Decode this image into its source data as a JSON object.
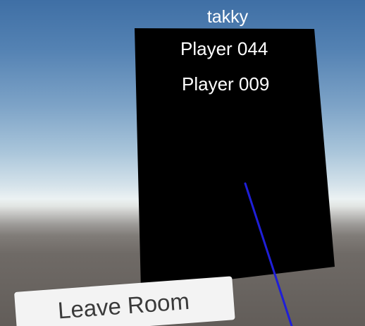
{
  "room": {
    "name": "takky"
  },
  "player_list": {
    "players": [
      "Player 044",
      "Player 009"
    ]
  },
  "buttons": {
    "leave_room_label": "Leave Room"
  },
  "colors": {
    "sky_top": "#3f6fa5",
    "horizon": "#ecf2f3",
    "ground": "#625d59",
    "panel": "#000000",
    "pointer_ray": "#1f1fd8",
    "button_bg": "#f3f3f3"
  }
}
